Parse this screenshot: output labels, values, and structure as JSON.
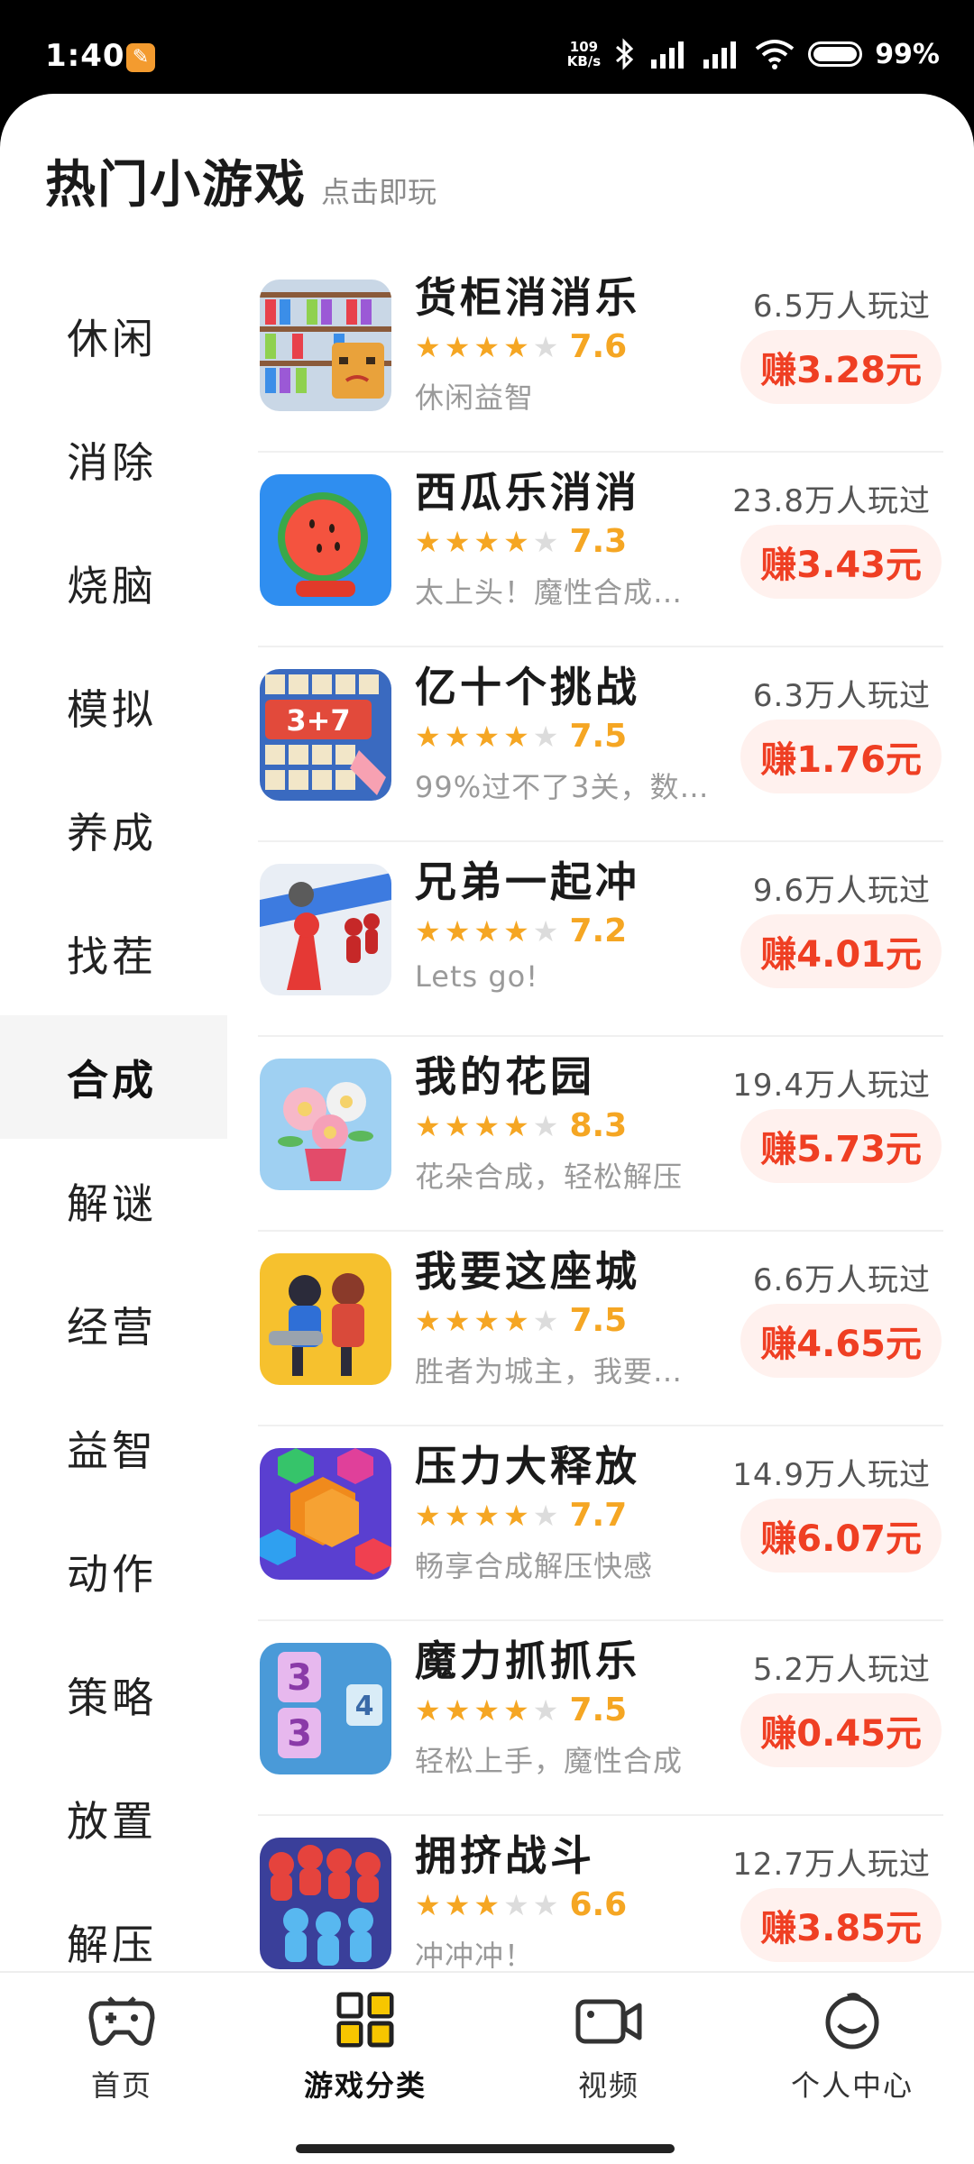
{
  "status_bar": {
    "time": "1:40",
    "speed_value": "109",
    "speed_unit": "KB/s",
    "battery": "99%"
  },
  "header": {
    "title": "热门小游戏",
    "subtitle": "点击即玩"
  },
  "sidebar": {
    "items": [
      {
        "label": "休闲"
      },
      {
        "label": "消除"
      },
      {
        "label": "烧脑"
      },
      {
        "label": "模拟"
      },
      {
        "label": "养成"
      },
      {
        "label": "找茬"
      },
      {
        "label": "合成",
        "active": true
      },
      {
        "label": "解谜"
      },
      {
        "label": "经营"
      },
      {
        "label": "益智"
      },
      {
        "label": "动作"
      },
      {
        "label": "策略"
      },
      {
        "label": "放置"
      },
      {
        "label": "解压"
      }
    ]
  },
  "games": [
    {
      "name": "货柜消消乐",
      "rating": "7.6",
      "stars": 3.5,
      "desc": "休闲益智",
      "players": "6.5万人玩过",
      "earn": "赚3.28元"
    },
    {
      "name": "西瓜乐消消",
      "rating": "7.3",
      "stars": 3.5,
      "desc": "太上头！魔性合成…",
      "players": "23.8万人玩过",
      "earn": "赚3.43元"
    },
    {
      "name": "亿十个挑战",
      "rating": "7.5",
      "stars": 3.5,
      "desc": "99%过不了3关，数…",
      "players": "6.3万人玩过",
      "earn": "赚1.76元"
    },
    {
      "name": "兄弟一起冲",
      "rating": "7.2",
      "stars": 3.5,
      "desc": "Lets go!",
      "players": "9.6万人玩过",
      "earn": "赚4.01元"
    },
    {
      "name": "我的花园",
      "rating": "8.3",
      "stars": 4,
      "desc": "花朵合成，轻松解压",
      "players": "19.4万人玩过",
      "earn": "赚5.73元"
    },
    {
      "name": "我要这座城",
      "rating": "7.5",
      "stars": 3.5,
      "desc": "胜者为城主，我要…",
      "players": "6.6万人玩过",
      "earn": "赚4.65元"
    },
    {
      "name": "压力大释放",
      "rating": "7.7",
      "stars": 3.5,
      "desc": "畅享合成解压快感",
      "players": "14.9万人玩过",
      "earn": "赚6.07元"
    },
    {
      "name": "魔力抓抓乐",
      "rating": "7.5",
      "stars": 3.5,
      "desc": "轻松上手，魔性合成",
      "players": "5.2万人玩过",
      "earn": "赚0.45元"
    },
    {
      "name": "拥挤战斗",
      "rating": "6.6",
      "stars": 3,
      "desc": "冲冲冲！",
      "players": "12.7万人玩过",
      "earn": "赚3.85元"
    }
  ],
  "bottom_nav": {
    "items": [
      {
        "label": "首页",
        "icon": "gamepad-icon"
      },
      {
        "label": "游戏分类",
        "icon": "grid-icon",
        "active": true
      },
      {
        "label": "视频",
        "icon": "video-icon"
      },
      {
        "label": "个人中心",
        "icon": "smiley-icon"
      }
    ]
  },
  "colors": {
    "accent_orange": "#f5a623",
    "earn_red": "#ef3f23",
    "earn_bg": "#fff1ee",
    "nav_active_yellow": "#f7c600"
  }
}
